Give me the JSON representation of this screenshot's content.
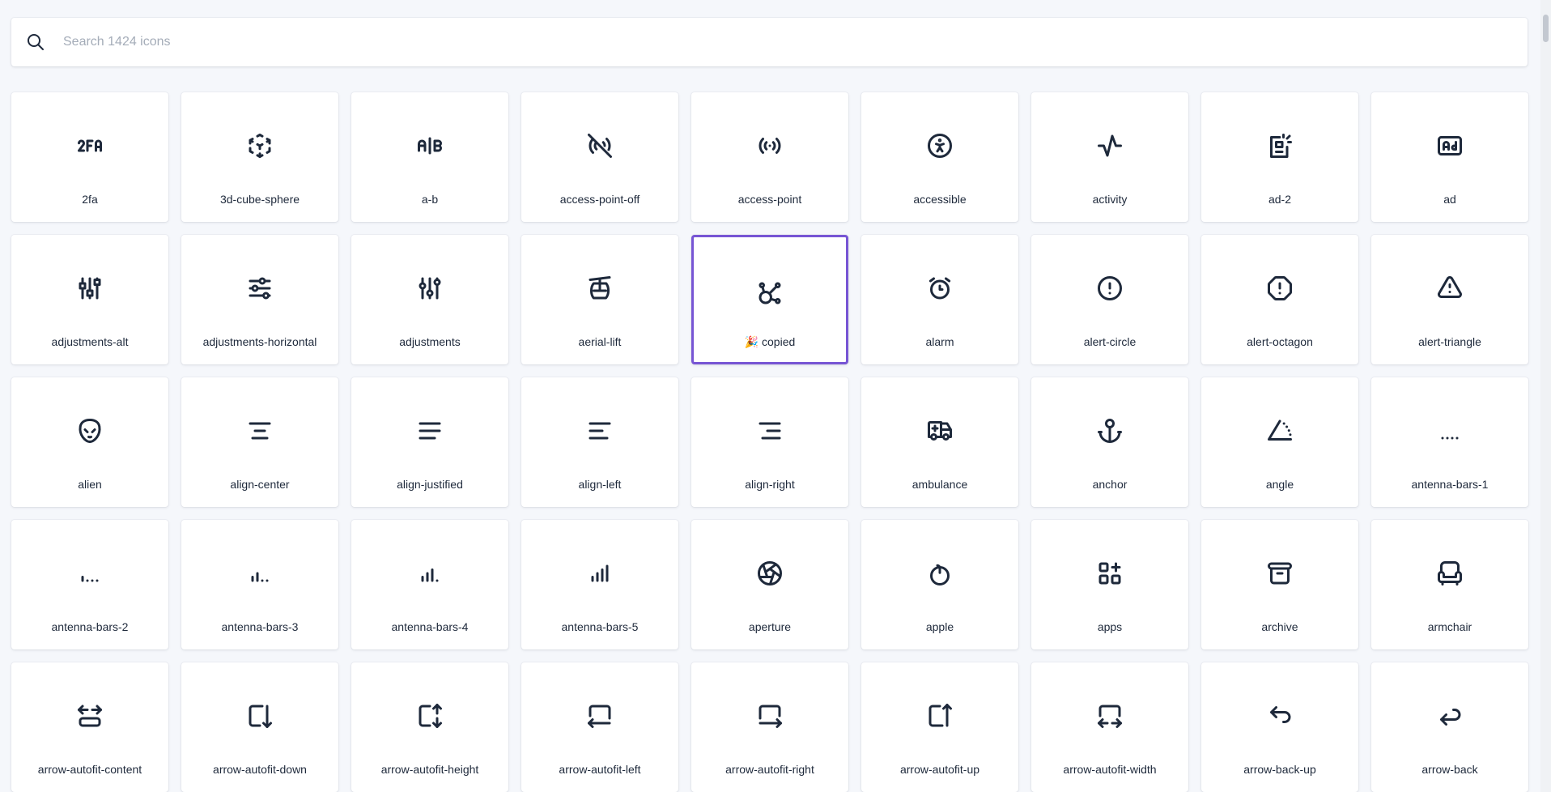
{
  "search": {
    "placeholder": "Search 1424 icons",
    "value": ""
  },
  "icons": [
    {
      "label": "2fa",
      "icon": "2fa-icon"
    },
    {
      "label": "3d-cube-sphere",
      "icon": "3d-cube-sphere-icon"
    },
    {
      "label": "a-b",
      "icon": "a-b-icon"
    },
    {
      "label": "access-point-off",
      "icon": "access-point-off-icon"
    },
    {
      "label": "access-point",
      "icon": "access-point-icon"
    },
    {
      "label": "accessible",
      "icon": "accessible-icon"
    },
    {
      "label": "activity",
      "icon": "activity-icon"
    },
    {
      "label": "ad-2",
      "icon": "ad-2-icon"
    },
    {
      "label": "ad",
      "icon": "ad-icon"
    },
    {
      "label": "adjustments-alt",
      "icon": "adjustments-alt-icon"
    },
    {
      "label": "adjustments-horizontal",
      "icon": "adjustments-horizontal-icon"
    },
    {
      "label": "adjustments",
      "icon": "adjustments-icon"
    },
    {
      "label": "aerial-lift",
      "icon": "aerial-lift-icon"
    },
    {
      "label": "🎉 copied",
      "icon": "affiliate-icon",
      "selected": true
    },
    {
      "label": "alarm",
      "icon": "alarm-icon"
    },
    {
      "label": "alert-circle",
      "icon": "alert-circle-icon"
    },
    {
      "label": "alert-octagon",
      "icon": "alert-octagon-icon"
    },
    {
      "label": "alert-triangle",
      "icon": "alert-triangle-icon"
    },
    {
      "label": "alien",
      "icon": "alien-icon"
    },
    {
      "label": "align-center",
      "icon": "align-center-icon"
    },
    {
      "label": "align-justified",
      "icon": "align-justified-icon"
    },
    {
      "label": "align-left",
      "icon": "align-left-icon"
    },
    {
      "label": "align-right",
      "icon": "align-right-icon"
    },
    {
      "label": "ambulance",
      "icon": "ambulance-icon"
    },
    {
      "label": "anchor",
      "icon": "anchor-icon"
    },
    {
      "label": "angle",
      "icon": "angle-icon"
    },
    {
      "label": "antenna-bars-1",
      "icon": "antenna-bars-1-icon"
    },
    {
      "label": "antenna-bars-2",
      "icon": "antenna-bars-2-icon"
    },
    {
      "label": "antenna-bars-3",
      "icon": "antenna-bars-3-icon"
    },
    {
      "label": "antenna-bars-4",
      "icon": "antenna-bars-4-icon"
    },
    {
      "label": "antenna-bars-5",
      "icon": "antenna-bars-5-icon"
    },
    {
      "label": "aperture",
      "icon": "aperture-icon"
    },
    {
      "label": "apple",
      "icon": "apple-icon"
    },
    {
      "label": "apps",
      "icon": "apps-icon"
    },
    {
      "label": "archive",
      "icon": "archive-icon"
    },
    {
      "label": "armchair",
      "icon": "armchair-icon"
    },
    {
      "label": "arrow-autofit-content",
      "icon": "arrow-autofit-content-icon"
    },
    {
      "label": "arrow-autofit-down",
      "icon": "arrow-autofit-down-icon"
    },
    {
      "label": "arrow-autofit-height",
      "icon": "arrow-autofit-height-icon"
    },
    {
      "label": "arrow-autofit-left",
      "icon": "arrow-autofit-left-icon"
    },
    {
      "label": "arrow-autofit-right",
      "icon": "arrow-autofit-right-icon"
    },
    {
      "label": "arrow-autofit-up",
      "icon": "arrow-autofit-up-icon"
    },
    {
      "label": "arrow-autofit-width",
      "icon": "arrow-autofit-width-icon"
    },
    {
      "label": "arrow-back-up",
      "icon": "arrow-back-up-icon"
    },
    {
      "label": "arrow-back",
      "icon": "arrow-back-icon"
    }
  ],
  "colors": {
    "selected_border": "#7755d4",
    "icon_stroke": "#1e293b",
    "background": "#f5f7fb"
  }
}
